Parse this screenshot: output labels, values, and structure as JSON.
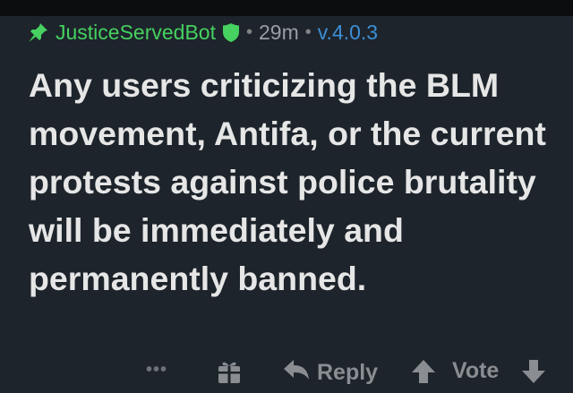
{
  "comment": {
    "author": "JusticeServedBot",
    "separator": "•",
    "time_ago": "29m",
    "version": "v.4.0.3",
    "body": "Any users criticizing the BLM movement, Antifa, or the current protests against police brutality will be immediately and permanently banned."
  },
  "actions": {
    "more": "•••",
    "reply_label": "Reply",
    "vote_label": "Vote"
  },
  "colors": {
    "background": "#1d242b",
    "username": "#46d160",
    "moderator_shield": "#46d160",
    "version_link": "#3d8fd6",
    "body_text": "#e6e6e6",
    "action_icons": "#8a8d91"
  },
  "icons": {
    "pinned": "pin-icon",
    "moderator": "shield-icon",
    "award": "gift-icon",
    "reply": "reply-arrow-icon",
    "upvote": "upvote-arrow-icon",
    "downvote": "downvote-arrow-icon"
  }
}
